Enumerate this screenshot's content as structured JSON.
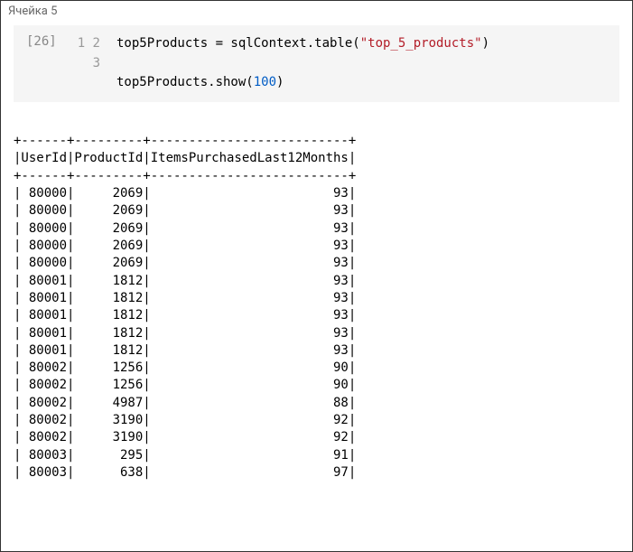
{
  "cell_label": "Ячейка 5",
  "exec_count": "[26]",
  "line_numbers": [
    "1",
    "2",
    "3"
  ],
  "code": {
    "var1": "top5Products",
    "eq": " = ",
    "ctx": "sqlContext.table(",
    "tableName": "\"top_5_products\"",
    "closeParen": ")",
    "var2": "top5Products.show(",
    "showArg": "100",
    "closeParen2": ")"
  },
  "output": {
    "columns": [
      "UserId",
      "ProductId",
      "ItemsPurchasedLast12Months"
    ],
    "widths": [
      6,
      9,
      26
    ],
    "rows": [
      [
        "80000",
        "2069",
        "93"
      ],
      [
        "80000",
        "2069",
        "93"
      ],
      [
        "80000",
        "2069",
        "93"
      ],
      [
        "80000",
        "2069",
        "93"
      ],
      [
        "80000",
        "2069",
        "93"
      ],
      [
        "80001",
        "1812",
        "93"
      ],
      [
        "80001",
        "1812",
        "93"
      ],
      [
        "80001",
        "1812",
        "93"
      ],
      [
        "80001",
        "1812",
        "93"
      ],
      [
        "80001",
        "1812",
        "93"
      ],
      [
        "80002",
        "1256",
        "90"
      ],
      [
        "80002",
        "1256",
        "90"
      ],
      [
        "80002",
        "4987",
        "88"
      ],
      [
        "80002",
        "3190",
        "92"
      ],
      [
        "80002",
        "3190",
        "92"
      ],
      [
        "80003",
        "295",
        "91"
      ],
      [
        "80003",
        "638",
        "97"
      ]
    ]
  }
}
